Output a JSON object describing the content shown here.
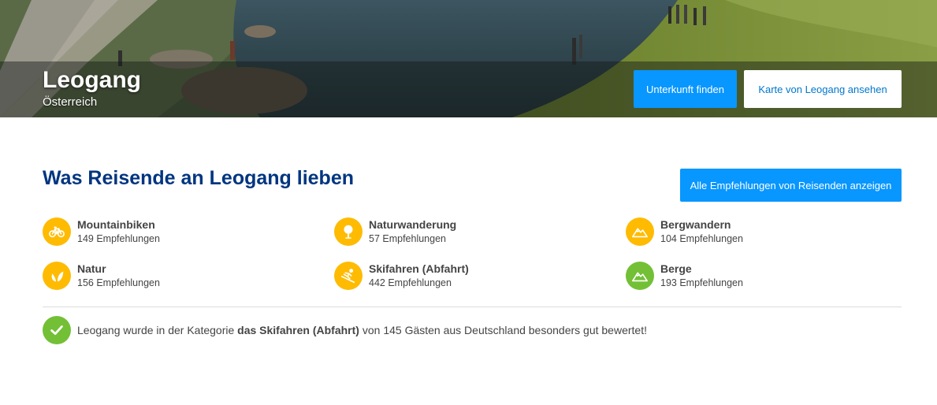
{
  "hero": {
    "title": "Leogang",
    "subtitle": "Österreich",
    "find_button": "Unterkunft finden",
    "map_button": "Karte von Leogang ansehen"
  },
  "main": {
    "section_title": "Was Reisende an Leogang lieben",
    "all_button": "Alle Empfehlungen von Reisenden anzeigen"
  },
  "activities": [
    {
      "label": "Mountainbiken",
      "count": "149 Empfehlungen",
      "icon": "bicycle-icon",
      "color": "#febb02"
    },
    {
      "label": "Naturwanderung",
      "count": "57 Empfehlungen",
      "icon": "tree-icon",
      "color": "#febb02"
    },
    {
      "label": "Bergwandern",
      "count": "104 Empfehlungen",
      "icon": "mountain-icon",
      "color": "#febb02"
    },
    {
      "label": "Natur",
      "count": "156 Empfehlungen",
      "icon": "leaf-icon",
      "color": "#febb02"
    },
    {
      "label": "Skifahren (Abfahrt)",
      "count": "442 Empfehlungen",
      "icon": "skiing-icon",
      "color": "#febb02"
    },
    {
      "label": "Berge",
      "count": "193 Empfehlungen",
      "icon": "mountain-icon",
      "color": "#73c036"
    }
  ],
  "note": {
    "prefix": "Leogang wurde in der Kategorie ",
    "highlight": "das Skifahren (Abfahrt)",
    "suffix": " von 145 Gästen aus Deutschland besonders gut bewertet!",
    "icon": "checkmark-icon",
    "color": "#73c036"
  }
}
